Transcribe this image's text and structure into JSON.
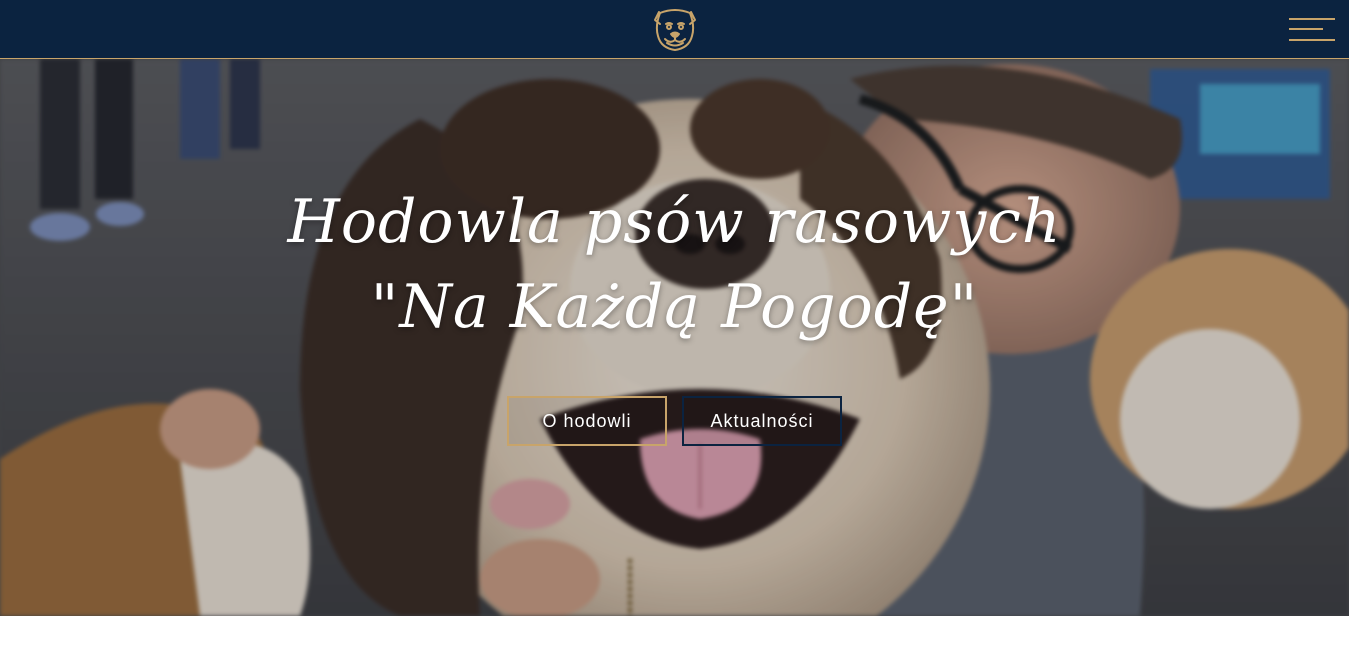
{
  "header": {
    "logo_icon": "bulldog-logo-icon",
    "menu_icon": "hamburger-menu-icon",
    "background_color": "#0b2340",
    "accent_color": "#c8a46a"
  },
  "hero": {
    "title_line1": "Hodowla psów rasowych",
    "title_line2": "\"Na Każdą Pogodę\"",
    "buttons": {
      "about_label": "O hodowli",
      "news_label": "Aktualności"
    }
  }
}
